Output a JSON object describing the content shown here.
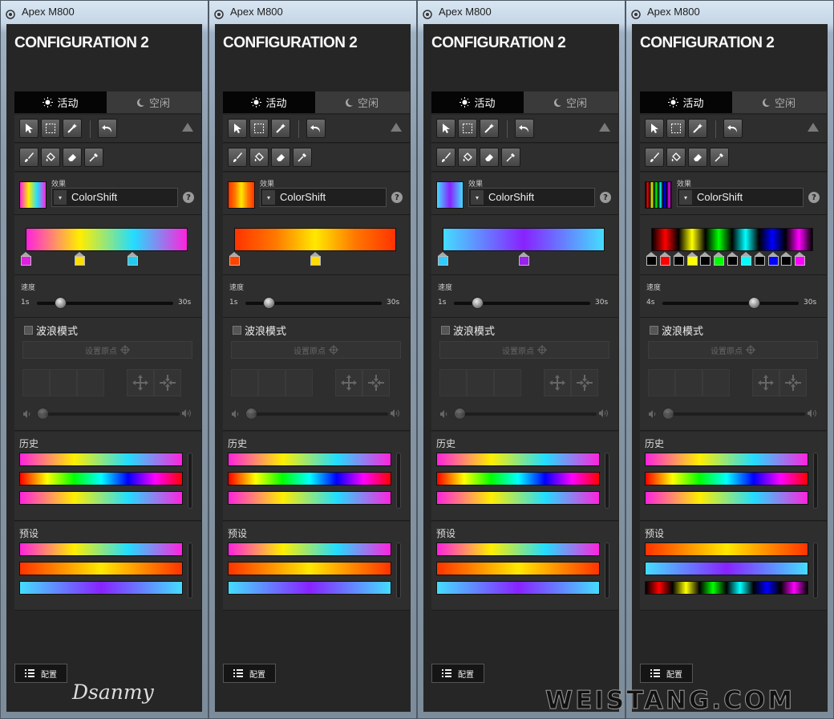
{
  "app_title": "Apex M800",
  "config_title": "CONFIGURATION 2",
  "tabs": {
    "active": "活动",
    "idle": "空闲"
  },
  "effect_label": "效果",
  "effect_value": "ColorShift",
  "help_glyph": "?",
  "dropdown_glyph": "▾",
  "speed_label": "速度",
  "wave_mode_label": "波浪模式",
  "set_origin_label": "设置原点",
  "history_label": "历史",
  "presets_label": "预设",
  "footer_button_label": "配置",
  "signature": "Dsanmy",
  "watermark": "WEISTANG.COM",
  "icons": {
    "toolbar_row1": [
      "pointer-icon",
      "marquee-select-icon",
      "magic-wand-icon",
      "undo-icon"
    ],
    "toolbar_row2": [
      "brush-icon",
      "fill-bucket-icon",
      "eraser-icon",
      "eyedropper-icon"
    ],
    "collapse": "collapse-triangle-icon",
    "volume_low": "speaker-low-icon",
    "volume_high": "speaker-high-icon",
    "expand": "expand-arrows-icon",
    "contract": "contract-arrows-icon",
    "crosshair": "crosshair-icon",
    "list": "list-icon"
  },
  "panels": [
    {
      "speed_min": "1s",
      "speed_max": "30s",
      "speed_value": 0.17,
      "gradient": [
        "#ff22dd",
        "#ffee00",
        "#22ddff",
        "#ff22dd"
      ],
      "stops": [
        {
          "color": "#e020e0",
          "pos": 0.0
        },
        {
          "color": "#ffdd00",
          "pos": 0.33
        },
        {
          "color": "#22ccee",
          "pos": 0.66
        }
      ]
    },
    {
      "speed_min": "1s",
      "speed_max": "30s",
      "speed_value": 0.17,
      "gradient": [
        "#ff3300",
        "#ff7700",
        "#ffe800",
        "#ff7700",
        "#ff3300"
      ],
      "stops": [
        {
          "color": "#ff4400",
          "pos": 0.0
        },
        {
          "color": "#ffdd00",
          "pos": 0.5
        }
      ]
    },
    {
      "speed_min": "1s",
      "speed_max": "30s",
      "speed_value": 0.17,
      "gradient": [
        "#44ddff",
        "#8822ff",
        "#44ddff"
      ],
      "stops": [
        {
          "color": "#33ccff",
          "pos": 0.0
        },
        {
          "color": "#9922ee",
          "pos": 0.5
        }
      ]
    },
    {
      "speed_min": "4s",
      "speed_max": "30s",
      "speed_value": 0.67,
      "gradient": [
        "#000",
        "#ff0000",
        "#000",
        "#ffff00",
        "#000",
        "#00ff00",
        "#000",
        "#00ffff",
        "#000",
        "#0000ff",
        "#000",
        "#ff00ff",
        "#000"
      ],
      "stops": [
        {
          "color": "#000000",
          "pos": 0.0
        },
        {
          "color": "#ff0000",
          "pos": 0.083
        },
        {
          "color": "#000000",
          "pos": 0.167
        },
        {
          "color": "#ffff00",
          "pos": 0.25
        },
        {
          "color": "#000000",
          "pos": 0.333
        },
        {
          "color": "#00ff00",
          "pos": 0.417
        },
        {
          "color": "#000000",
          "pos": 0.5
        },
        {
          "color": "#00ffff",
          "pos": 0.583
        },
        {
          "color": "#000000",
          "pos": 0.667
        },
        {
          "color": "#0000ff",
          "pos": 0.75
        },
        {
          "color": "#000000",
          "pos": 0.833
        },
        {
          "color": "#ff00ff",
          "pos": 0.917
        }
      ]
    }
  ],
  "history_gradients": [
    [
      "#ff22dd",
      "#ffee00",
      "#22ddff",
      "#ff22dd"
    ],
    [
      "#ff0000",
      "#ffff00",
      "#00ff00",
      "#00ffff",
      "#0000ff",
      "#ff00ff",
      "#ff0000"
    ],
    [
      "#ff22dd",
      "#ffee00",
      "#22ddff",
      "#ff22dd"
    ]
  ],
  "preset_gradients_default": [
    [
      "#ff22dd",
      "#ffee00",
      "#22ddff",
      "#ff22dd"
    ],
    [
      "#ff3300",
      "#ffe800",
      "#ff3300"
    ],
    [
      "#44ddff",
      "#8822ff",
      "#44ddff"
    ]
  ],
  "preset_gradients_last": [
    [
      "#ff3300",
      "#ffe800",
      "#ff3300"
    ],
    [
      "#44ddff",
      "#8822ff",
      "#44ddff"
    ],
    [
      "#000",
      "#ff0000",
      "#000",
      "#ffff00",
      "#000",
      "#00ff00",
      "#000",
      "#00ffff",
      "#000",
      "#0000ff",
      "#000",
      "#ff00ff",
      "#000"
    ]
  ]
}
